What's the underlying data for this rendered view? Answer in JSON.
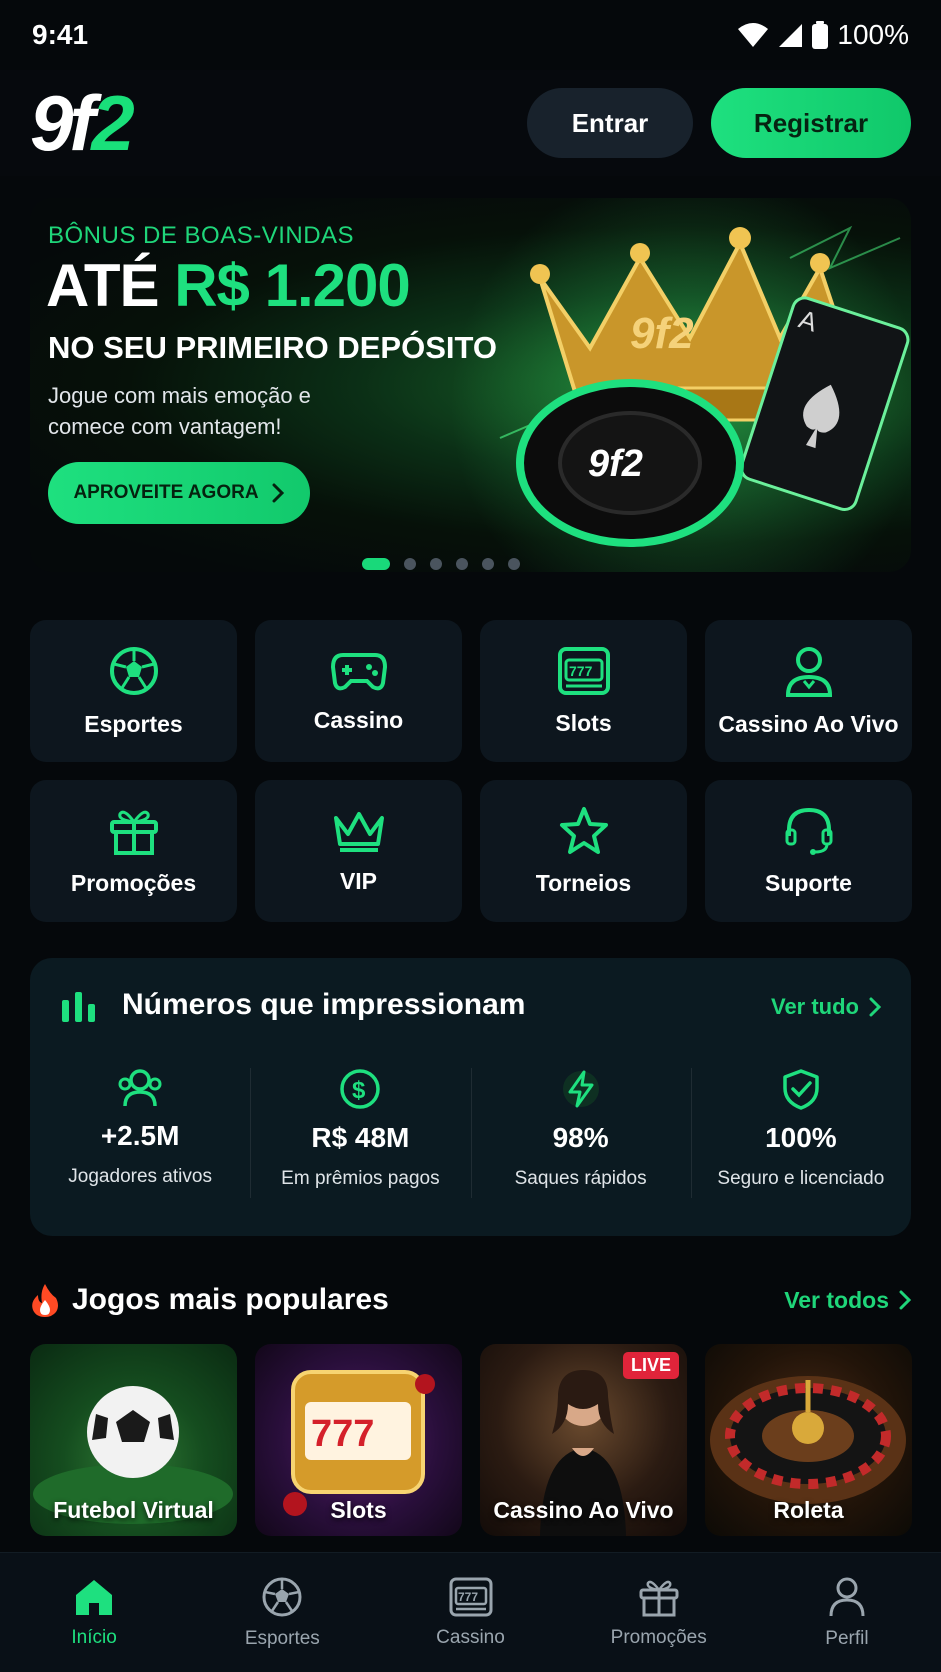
{
  "status_bar": {
    "time": "9:41",
    "battery": "100%"
  },
  "header": {
    "logo_part1": "9f",
    "logo_part2": "2",
    "login_label": "Entrar",
    "register_label": "Registrar"
  },
  "banner": {
    "eyebrow": "BÔNUS DE BOAS-VINDAS",
    "headline_prefix": "ATÉ ",
    "headline_amount": "R$ 1.200",
    "subheadline": "NO SEU PRIMEIRO DEPÓSITO",
    "description": "Jogue com mais emoção e comece com vantagem!",
    "cta_label": "APROVEITE AGORA",
    "art_chip_text": "9f2",
    "art_crown_text": "9f2",
    "slide_count": 6,
    "active_slide": 1
  },
  "categories": [
    {
      "label": "Esportes",
      "icon": "soccer-ball-icon"
    },
    {
      "label": "Cassino",
      "icon": "gamepad-icon"
    },
    {
      "label": "Slots",
      "icon": "slot-machine-icon"
    },
    {
      "label": "Cassino Ao Vivo",
      "icon": "dealer-icon"
    },
    {
      "label": "Promoções",
      "icon": "gift-icon"
    },
    {
      "label": "VIP",
      "icon": "crown-icon"
    },
    {
      "label": "Torneios",
      "icon": "star-icon"
    },
    {
      "label": "Suporte",
      "icon": "headset-icon"
    }
  ],
  "stats": {
    "title": "Números que impressionam",
    "link_label": "Ver tudo",
    "items": [
      {
        "value": "+2.5M",
        "label": "Jogadores ativos",
        "icon": "users-icon"
      },
      {
        "value": "R$ 48M",
        "label": "Em prêmios pagos",
        "icon": "dollar-coin-icon"
      },
      {
        "value": "98%",
        "label": "Saques rápidos",
        "icon": "lightning-icon"
      },
      {
        "value": "100%",
        "label": "Seguro e licenciado",
        "icon": "shield-check-icon"
      }
    ]
  },
  "popular": {
    "title": "Jogos mais populares",
    "link_label": "Ver todos",
    "games": [
      {
        "label": "Futebol Virtual"
      },
      {
        "label": "Slots"
      },
      {
        "label": "Cassino Ao Vivo",
        "badge": "LIVE"
      },
      {
        "label": "Roleta"
      }
    ]
  },
  "bottom_nav": [
    {
      "label": "Início",
      "icon": "home-icon",
      "active": true
    },
    {
      "label": "Esportes",
      "icon": "soccer-ball-icon"
    },
    {
      "label": "Cassino",
      "icon": "slot-machine-icon"
    },
    {
      "label": "Promoções",
      "icon": "gift-icon"
    },
    {
      "label": "Perfil",
      "icon": "user-icon"
    }
  ],
  "colors": {
    "accent": "#1ee07f",
    "background": "#05080b",
    "tile": "#0d161e",
    "live": "#e0243a"
  }
}
